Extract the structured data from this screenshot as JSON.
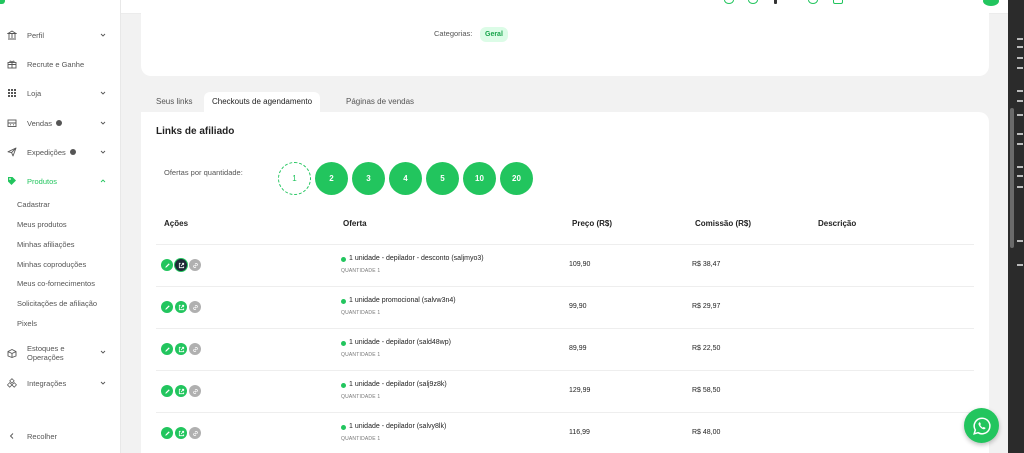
{
  "sidebar": {
    "items": [
      {
        "label": "Perfil",
        "icon": "bank-icon"
      },
      {
        "label": "Recrute e Ganhe",
        "icon": "gift-icon"
      },
      {
        "label": "Loja",
        "icon": "grid-icon"
      },
      {
        "label": "Vendas",
        "icon": "cash-register-icon"
      },
      {
        "label": "Expedições",
        "icon": "paper-plane-icon"
      },
      {
        "label": "Produtos",
        "icon": "tag-icon"
      },
      {
        "label": "Estoques e Operações",
        "icon": "box-icon"
      },
      {
        "label": "Integrações",
        "icon": "puzzle-icon"
      }
    ],
    "produtos_sub": [
      "Cadastrar",
      "Meus produtos",
      "Minhas afiliações",
      "Minhas coproduções",
      "Meus co-fornecimentos",
      "Solicitações de afiliação",
      "Pixels"
    ],
    "estoques_line1": "Estoques e",
    "estoques_line2": "Operações",
    "collapse_label": "Recolher"
  },
  "top_card": {
    "categories_label": "Categorias:",
    "category_badge": "Geral"
  },
  "tabs": [
    "Seus links",
    "Checkouts de agendamento",
    "Páginas de vendas"
  ],
  "main": {
    "title": "Links de afiliado",
    "qty_label": "Ofertas por quantidade:",
    "qty_options": [
      "1",
      "2",
      "3",
      "4",
      "5",
      "10",
      "20"
    ],
    "selected_qty": "1",
    "columns": [
      "Ações",
      "Oferta",
      "Preço (R$)",
      "Comissão (R$)",
      "Descrição"
    ],
    "rows": [
      {
        "offer": "1 unidade - depilador - desconto (saljmyo3)",
        "qty": "QUANTIDADE 1",
        "price": "109,90",
        "commission": "R$ 38,47",
        "description": ""
      },
      {
        "offer": "1 unidade promocional (salvw3n4)",
        "qty": "QUANTIDADE 1",
        "price": "99,90",
        "commission": "R$ 29,97",
        "description": ""
      },
      {
        "offer": "1 unidade - depilador (sald48wp)",
        "qty": "QUANTIDADE 1",
        "price": "89,99",
        "commission": "R$ 22,50",
        "description": ""
      },
      {
        "offer": "1 unidade - depilador (salj9z8k)",
        "qty": "QUANTIDADE 1",
        "price": "129,99",
        "commission": "R$ 58,50",
        "description": ""
      },
      {
        "offer": "1 unidade - depilador (salvy8lk)",
        "qty": "QUANTIDADE 1",
        "price": "116,99",
        "commission": "R$ 48,00",
        "description": ""
      }
    ]
  },
  "colors": {
    "accent": "#22c55e",
    "badge_bg": "#dcfce7",
    "badge_text": "#16a34a"
  }
}
